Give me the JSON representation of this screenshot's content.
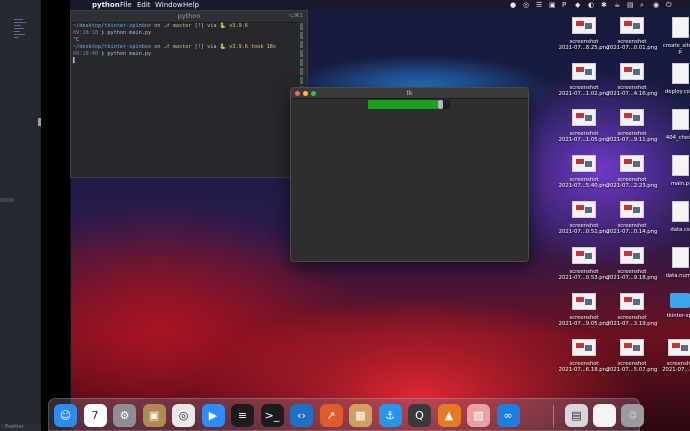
{
  "menubar": {
    "apple_glyph": "",
    "app_name": "python",
    "items": [
      "File",
      "Edit",
      "Window",
      "Help"
    ],
    "status_glyphs": [
      "●",
      "◎",
      "☰",
      "▣",
      "P",
      "◆",
      "◐",
      "✱",
      "☕",
      "▤",
      "⌕",
      "◉",
      "⏻"
    ]
  },
  "editor": {
    "status_text": "· Prettier"
  },
  "terminal": {
    "title": "python",
    "shortcut": "⌥⌘1",
    "lines": [
      {
        "path": "~/desktop/tkinter-spinbox",
        "on": " on ",
        "branch_icon": "⎇ ",
        "branch": "master",
        "status": " [!] via ",
        "ver_icon": "🐍 ",
        "version": "v3.9.6",
        "took": ""
      },
      {
        "time": "09:18:18",
        "cmd": " ❯ python main.py"
      },
      {
        "text": "^C"
      },
      {
        "path": "~/desktop/tkinter-spinbox",
        "on": " on ",
        "branch_icon": "⎇ ",
        "branch": "master",
        "status": " [!] via ",
        "ver_icon": "🐍 ",
        "version": "v3.9.6",
        "took": " took 18s"
      },
      {
        "time": "09:18:40",
        "cmd": " ❯ python main.py"
      },
      {
        "text": "▌"
      }
    ]
  },
  "tk_window": {
    "title": "tk",
    "progress": 0.92,
    "progress_color": "#1aa01a",
    "traffic_lights": [
      "#ff5f57",
      "#febc2e",
      "#28c840"
    ]
  },
  "desktop_icons": [
    {
      "kind": "image",
      "label1": "screenshot",
      "label2": "2021-07...8.25.png"
    },
    {
      "kind": "image",
      "label1": "screenshot",
      "label2": "2021-07...0.01.png"
    },
    {
      "kind": "doc",
      "label1": "create_sitem",
      "label2": "p"
    },
    {
      "kind": "image",
      "label1": "screenshot",
      "label2": "2021-07...1.02.png"
    },
    {
      "kind": "image",
      "label1": "screenshot",
      "label2": "2021-07...4.16.png"
    },
    {
      "kind": "doc",
      "label1": "deploy.com",
      "label2": ""
    },
    {
      "kind": "image",
      "label1": "screenshot",
      "label2": "2021-07...1.05.png"
    },
    {
      "kind": "image",
      "label1": "screenshot",
      "label2": "2021-07...9.11.png"
    },
    {
      "kind": "doc",
      "label1": "404_check",
      "label2": ""
    },
    {
      "kind": "image",
      "label1": "screenshot",
      "label2": "2021-07...5.40.png"
    },
    {
      "kind": "image",
      "label1": "screenshot",
      "label2": "2021-07...2.23.png"
    },
    {
      "kind": "doc",
      "label1": "main.p",
      "label2": ""
    },
    {
      "kind": "image",
      "label1": "screenshot",
      "label2": "2021-07...0.51.png"
    },
    {
      "kind": "image",
      "label1": "screenshot",
      "label2": "2021-07...0.14.png"
    },
    {
      "kind": "doc",
      "label1": "data.cs",
      "label2": ""
    },
    {
      "kind": "image",
      "label1": "screenshot",
      "label2": "2021-07...0.53.png"
    },
    {
      "kind": "image",
      "label1": "screenshot",
      "label2": "2021-07...9.18.png"
    },
    {
      "kind": "doc",
      "label1": "data.numb",
      "label2": ""
    },
    {
      "kind": "image",
      "label1": "screenshot",
      "label2": "2021-07...9.05.png"
    },
    {
      "kind": "image",
      "label1": "screenshot",
      "label2": "2021-07...3.19.png"
    },
    {
      "kind": "folder",
      "label1": "tkinter-spi",
      "label2": ""
    },
    {
      "kind": "image",
      "label1": "screenshot",
      "label2": "2021-07...6.18.png"
    },
    {
      "kind": "image",
      "label1": "screenshot",
      "label2": "2021-07...5.07.png"
    },
    {
      "kind": "image",
      "label1": "screensho",
      "label2": "2021-07...8.2"
    }
  ],
  "dock": {
    "apps": [
      {
        "name": "finder",
        "color": "#2d8cf0",
        "glyph": "☺"
      },
      {
        "name": "calendar",
        "color": "#ffffff",
        "glyph": "7"
      },
      {
        "name": "system-preferences",
        "color": "#8e8e93",
        "glyph": "⚙"
      },
      {
        "name": "archive",
        "color": "#b08a50",
        "glyph": "▣"
      },
      {
        "name": "chrome",
        "color": "#e8e8e8",
        "glyph": "◎"
      },
      {
        "name": "zoom",
        "color": "#2d8cff",
        "glyph": "▶"
      },
      {
        "name": "activity-monitor",
        "color": "#1c1c1e",
        "glyph": "≡"
      },
      {
        "name": "terminal",
        "color": "#1c1c1e",
        "glyph": ">_"
      },
      {
        "name": "vscode",
        "color": "#1f6fc5",
        "glyph": "‹›"
      },
      {
        "name": "stats",
        "color": "#e05a2a",
        "glyph": "↗"
      },
      {
        "name": "package",
        "color": "#d0a060",
        "glyph": "▦"
      },
      {
        "name": "docker",
        "color": "#2496ed",
        "glyph": "⚓"
      },
      {
        "name": "quicktime",
        "color": "#3a3a3c",
        "glyph": "Q"
      },
      {
        "name": "sourcetree",
        "color": "#e57b22",
        "glyph": "▲"
      },
      {
        "name": "preview",
        "color": "#e8a0a0",
        "glyph": "▧"
      },
      {
        "name": "infinity",
        "color": "#1a7fe0",
        "glyph": "∞"
      }
    ],
    "right_items": [
      {
        "name": "downloads-stack",
        "color": "#d8d8dc",
        "glyph": "▤"
      },
      {
        "name": "document",
        "color": "#f4f4f6",
        "glyph": ""
      },
      {
        "name": "trash",
        "color": "#9a9aa0",
        "glyph": "♲"
      }
    ]
  }
}
